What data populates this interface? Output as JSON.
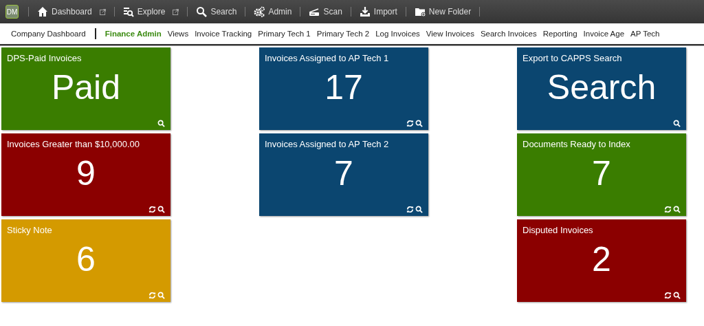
{
  "toolbar": {
    "logo": "DM",
    "items": [
      {
        "label": "Dashboard",
        "external": true
      },
      {
        "label": "Explore",
        "external": true
      },
      {
        "label": "Search",
        "external": false
      },
      {
        "label": "Admin",
        "external": false
      },
      {
        "label": "Scan",
        "external": false
      },
      {
        "label": "Import",
        "external": false
      },
      {
        "label": "New Folder",
        "external": false
      }
    ]
  },
  "nav": [
    {
      "label": "Company Dashboard",
      "selected": false
    },
    {
      "label": "Finance Admin",
      "selected": true
    },
    {
      "label": "Views",
      "selected": false
    },
    {
      "label": "Invoice Tracking",
      "selected": false
    },
    {
      "label": "Primary Tech 1",
      "selected": false
    },
    {
      "label": "Primary Tech 2",
      "selected": false
    },
    {
      "label": "Log Invoices",
      "selected": false
    },
    {
      "label": "View Invoices",
      "selected": false
    },
    {
      "label": "Search Invoices",
      "selected": false
    },
    {
      "label": "Reporting",
      "selected": false
    },
    {
      "label": "Invoice Age",
      "selected": false
    },
    {
      "label": "AP Tech",
      "selected": false
    }
  ],
  "columns": [
    {
      "tiles": [
        {
          "title": "DPS-Paid Invoices",
          "value": "Paid",
          "color": "#3a7d00",
          "refresh": false
        },
        {
          "title": "Invoices Greater than $10,000.00",
          "value": "9",
          "color": "#8b0000",
          "refresh": true
        },
        {
          "title": "Sticky Note",
          "value": "6",
          "color": "#d49a00",
          "refresh": true
        }
      ]
    },
    {
      "tiles": [
        {
          "title": "Invoices Assigned to AP Tech 1",
          "value": "17",
          "color": "#0b4670",
          "refresh": true
        },
        {
          "title": "Invoices Assigned to AP Tech 2",
          "value": "7",
          "color": "#0b4670",
          "refresh": true
        }
      ]
    },
    {
      "tiles": [
        {
          "title": "Export to CAPPS Search",
          "value": "Search",
          "color": "#0b4670",
          "refresh": false
        },
        {
          "title": "Documents Ready to Index",
          "value": "7",
          "color": "#3a7d00",
          "refresh": true
        },
        {
          "title": "Disputed Invoices",
          "value": "2",
          "color": "#8b0000",
          "refresh": true
        }
      ]
    }
  ]
}
